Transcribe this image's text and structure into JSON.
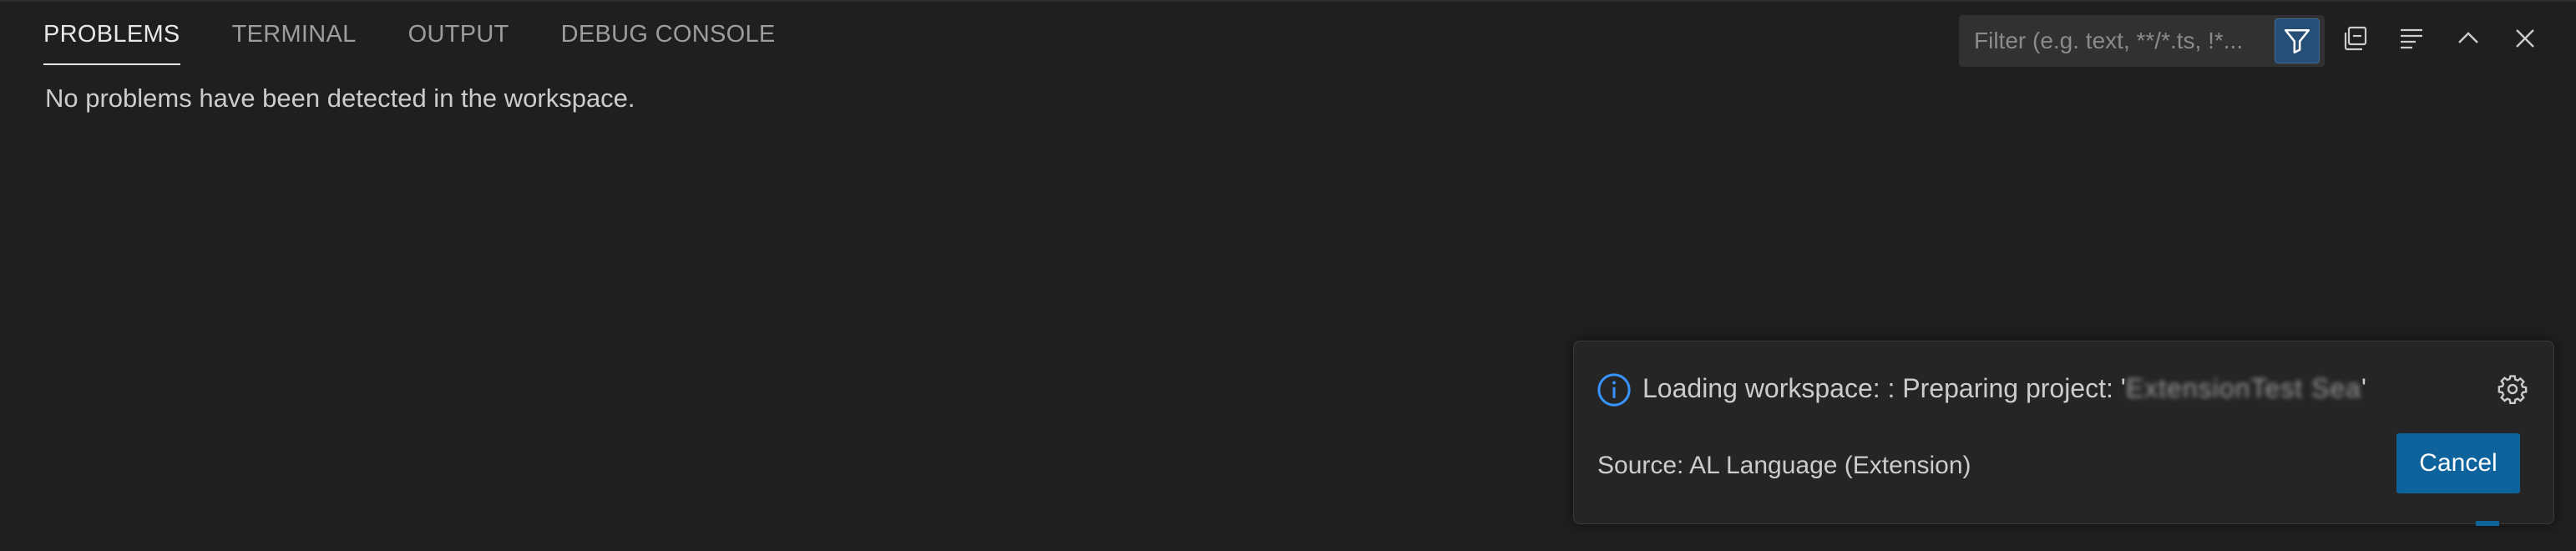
{
  "panel": {
    "tabs": [
      {
        "label": "PROBLEMS",
        "active": true
      },
      {
        "label": "TERMINAL",
        "active": false
      },
      {
        "label": "OUTPUT",
        "active": false
      },
      {
        "label": "DEBUG CONSOLE",
        "active": false
      }
    ],
    "empty_message": "No problems have been detected in the workspace."
  },
  "toolbar": {
    "filter_placeholder": "Filter (e.g. text, **/*.ts, !*...",
    "filter_value": "",
    "filter_icon": "filter-icon",
    "icons": [
      "filter-icon",
      "collapse-all-icon",
      "view-as-tree-icon",
      "chevron-up-icon",
      "close-icon"
    ]
  },
  "notification": {
    "message_prefix": "Loading workspace: : Preparing project: '",
    "project_name": "ExtensionTest Sea",
    "message_suffix": "'",
    "source": "Source: AL Language (Extension)",
    "cancel_label": "Cancel",
    "icons": [
      "info-icon",
      "gear-icon"
    ]
  },
  "colors": {
    "background": "#1f1f1f",
    "toast_background": "#252526",
    "accent": "#0e639c",
    "info": "#3794ff",
    "active_tab": "#e7e7e7",
    "inactive_tab": "#9d9d9d"
  }
}
